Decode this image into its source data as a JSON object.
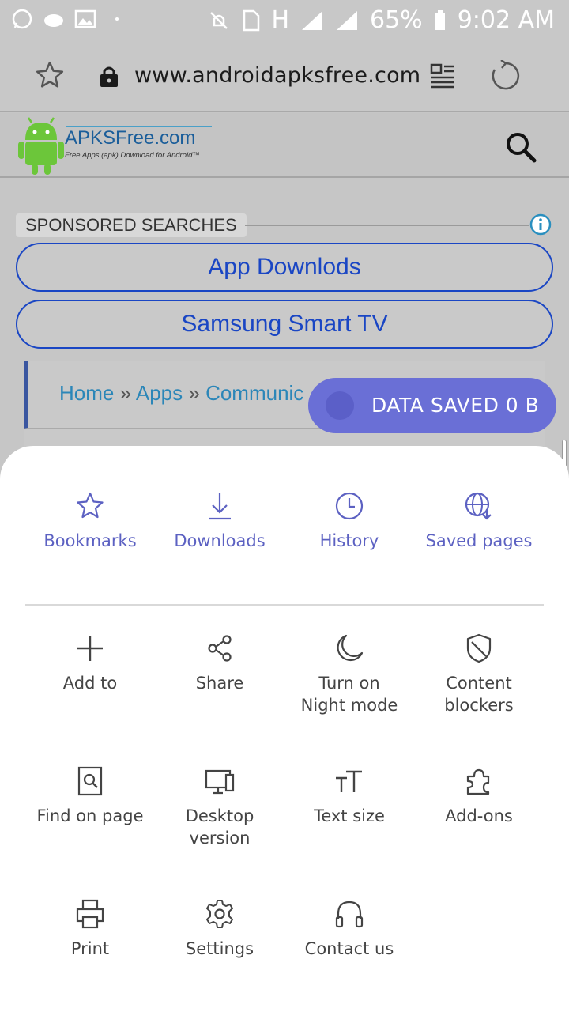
{
  "status_bar": {
    "battery": "65%",
    "time": "9:02 AM",
    "network": "H"
  },
  "browser": {
    "url": "www.androidapksfree.com"
  },
  "site": {
    "logo_title": "APKSFree.com",
    "logo_subtitle": "Free Apps (apk) Download for Android™"
  },
  "sponsored": {
    "label": "SPONSORED SEARCHES",
    "items": [
      "App Downlods",
      "Samsung Smart TV"
    ]
  },
  "breadcrumb": {
    "home": "Home",
    "sep": "»",
    "apps": "Apps",
    "current": "Communic"
  },
  "data_saved": {
    "label": "DATA SAVED 0 B"
  },
  "menu": {
    "top": [
      {
        "label": "Bookmarks",
        "icon": "star-icon"
      },
      {
        "label": "Downloads",
        "icon": "download-icon"
      },
      {
        "label": "History",
        "icon": "clock-icon"
      },
      {
        "label": "Saved pages",
        "icon": "globe-download-icon"
      }
    ],
    "grid": [
      {
        "label": "Add to",
        "icon": "plus-icon"
      },
      {
        "label": "Share",
        "icon": "share-icon"
      },
      {
        "label": "Turn on\nNight mode",
        "icon": "moon-icon"
      },
      {
        "label": "Content\nblockers",
        "icon": "shield-icon"
      },
      {
        "label": "Find on page",
        "icon": "find-page-icon"
      },
      {
        "label": "Desktop\nversion",
        "icon": "desktop-icon"
      },
      {
        "label": "Text size",
        "icon": "text-size-icon"
      },
      {
        "label": "Add-ons",
        "icon": "puzzle-icon"
      },
      {
        "label": "Print",
        "icon": "printer-icon"
      },
      {
        "label": "Settings",
        "icon": "gear-icon"
      },
      {
        "label": "Contact us",
        "icon": "headset-icon"
      }
    ]
  },
  "colors": {
    "accent": "#5c61c2",
    "data_saved_bg": "#6a6fd6",
    "link_blue": "#1a46c4"
  }
}
